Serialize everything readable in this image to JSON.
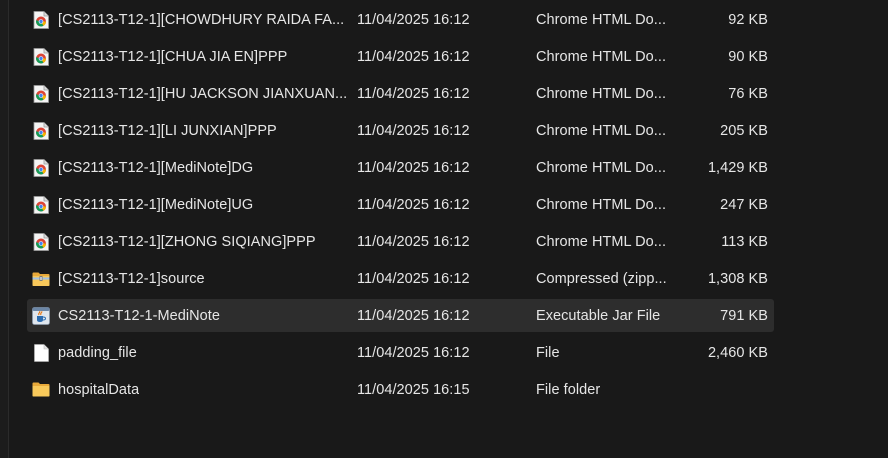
{
  "files": [
    {
      "name": "[CS2113-T12-1][CHOWDHURY RAIDA FA...",
      "date": "11/04/2025 16:12",
      "type": "Chrome HTML Do...",
      "size": "92 KB",
      "icon": "chrome-html-icon"
    },
    {
      "name": "[CS2113-T12-1][CHUA JIA EN]PPP",
      "date": "11/04/2025 16:12",
      "type": "Chrome HTML Do...",
      "size": "90 KB",
      "icon": "chrome-html-icon"
    },
    {
      "name": "[CS2113-T12-1][HU JACKSON JIANXUAN...",
      "date": "11/04/2025 16:12",
      "type": "Chrome HTML Do...",
      "size": "76 KB",
      "icon": "chrome-html-icon"
    },
    {
      "name": "[CS2113-T12-1][LI JUNXIAN]PPP",
      "date": "11/04/2025 16:12",
      "type": "Chrome HTML Do...",
      "size": "205 KB",
      "icon": "chrome-html-icon"
    },
    {
      "name": "[CS2113-T12-1][MediNote]DG",
      "date": "11/04/2025 16:12",
      "type": "Chrome HTML Do...",
      "size": "1,429 KB",
      "icon": "chrome-html-icon"
    },
    {
      "name": "[CS2113-T12-1][MediNote]UG",
      "date": "11/04/2025 16:12",
      "type": "Chrome HTML Do...",
      "size": "247 KB",
      "icon": "chrome-html-icon"
    },
    {
      "name": "[CS2113-T12-1][ZHONG SIQIANG]PPP",
      "date": "11/04/2025 16:12",
      "type": "Chrome HTML Do...",
      "size": "113 KB",
      "icon": "chrome-html-icon"
    },
    {
      "name": "[CS2113-T12-1]source",
      "date": "11/04/2025 16:12",
      "type": "Compressed (zipp...",
      "size": "1,308 KB",
      "icon": "zip-folder-icon"
    },
    {
      "name": "CS2113-T12-1-MediNote",
      "date": "11/04/2025 16:12",
      "type": "Executable Jar File",
      "size": "791 KB",
      "icon": "java-jar-icon",
      "selected": true
    },
    {
      "name": "padding_file",
      "date": "11/04/2025 16:12",
      "type": "File",
      "size": "2,460 KB",
      "icon": "blank-file-icon"
    },
    {
      "name": "hospitalData",
      "date": "11/04/2025 16:15",
      "type": "File folder",
      "size": "",
      "icon": "folder-icon"
    }
  ]
}
